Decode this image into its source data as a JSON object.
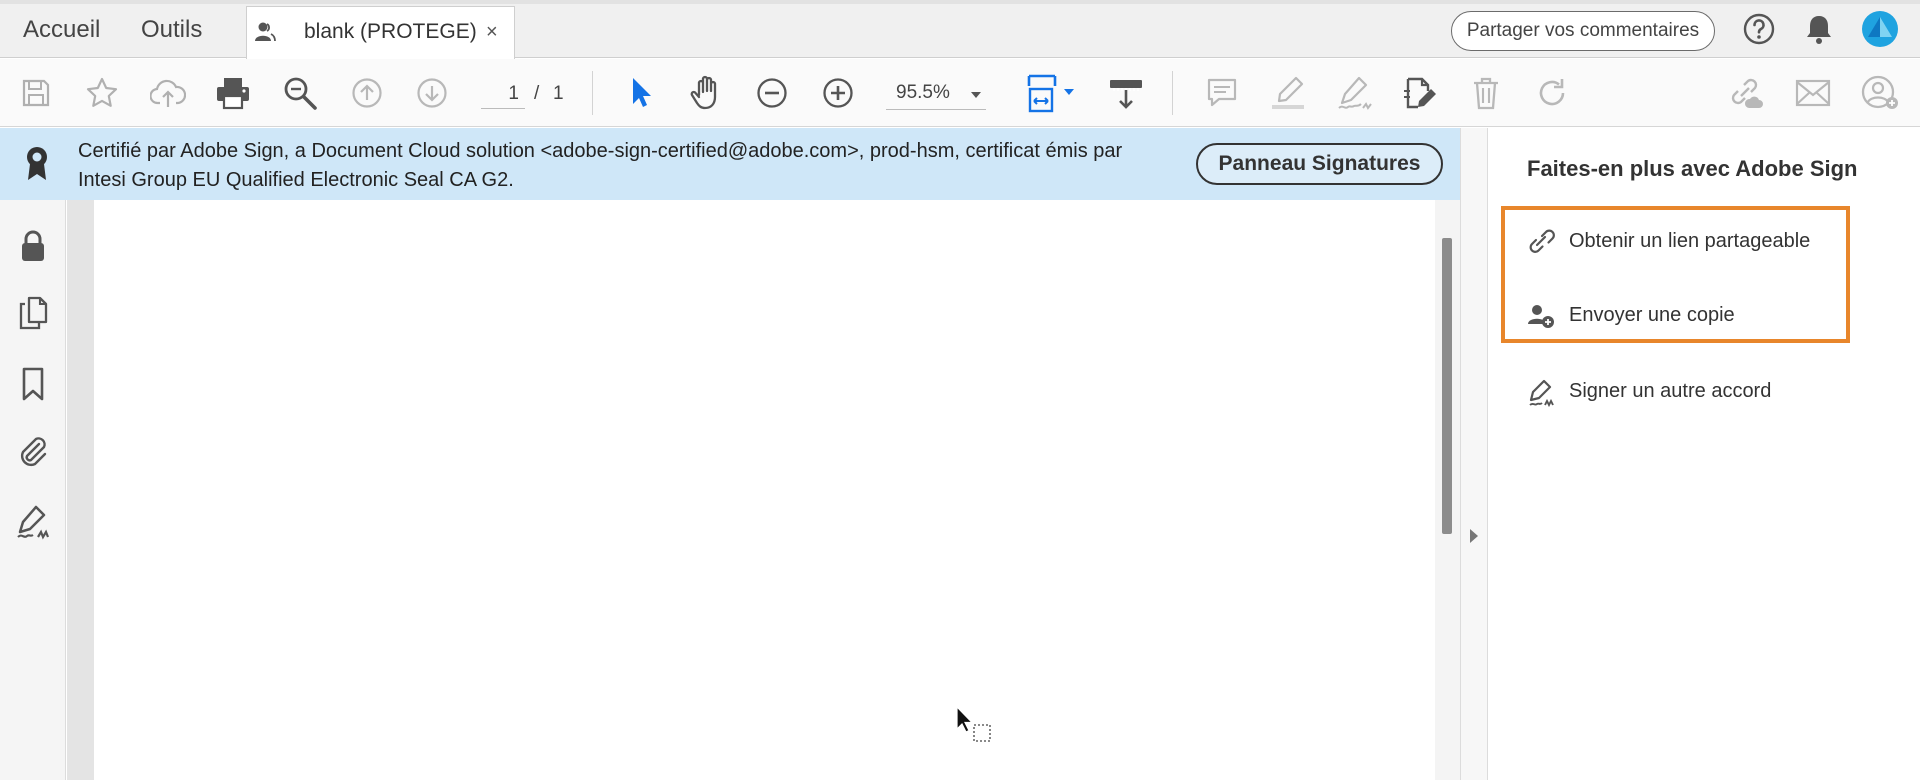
{
  "tabbar": {
    "home": "Accueil",
    "tools": "Outils",
    "document_tab": {
      "title": "blank (PROTEGE)",
      "close": "×"
    },
    "share_comments": "Partager vos commentaires"
  },
  "toolbar": {
    "page_current": "1",
    "page_separator": "/",
    "page_total": "1",
    "zoom": "95.5%"
  },
  "certificate": {
    "text": "Certifié par Adobe Sign, a Document Cloud solution <adobe-sign-certified@adobe.com>, prod-hsm, certificat émis par Intesi Group EU Qualified Electronic Seal CA G2.",
    "button": "Panneau Signatures"
  },
  "right_panel": {
    "title": "Faites-en plus avec Adobe Sign",
    "items": [
      {
        "label": "Obtenir un lien partageable",
        "icon": "link-icon"
      },
      {
        "label": "Envoyer une copie",
        "icon": "add-user-icon"
      },
      {
        "label": "Signer un autre accord",
        "icon": "sign-pen-icon"
      }
    ]
  },
  "colors": {
    "cert_bar": "#cfe7f8",
    "highlight": "#e8862b",
    "accent_blue": "#1473e6",
    "avatar": "#1fa3e0"
  },
  "icons": {
    "toolbar": [
      "save-icon",
      "star-icon",
      "upload-cloud-icon",
      "print-icon",
      "zoom-search-icon",
      "arrow-up-icon",
      "arrow-down-icon",
      "select-cursor-icon",
      "hand-icon",
      "zoom-out-icon",
      "zoom-in-icon",
      "fit-page-icon",
      "scroll-mode-icon",
      "comment-icon",
      "highlighter-icon",
      "sign-icon",
      "edit-pdf-icon",
      "trash-icon",
      "redo-icon",
      "share-link-icon",
      "mail-icon",
      "user-icon"
    ],
    "left_rail": [
      "lock-icon",
      "pages-icon",
      "bookmark-icon",
      "attachment-icon",
      "signature-icon"
    ]
  }
}
